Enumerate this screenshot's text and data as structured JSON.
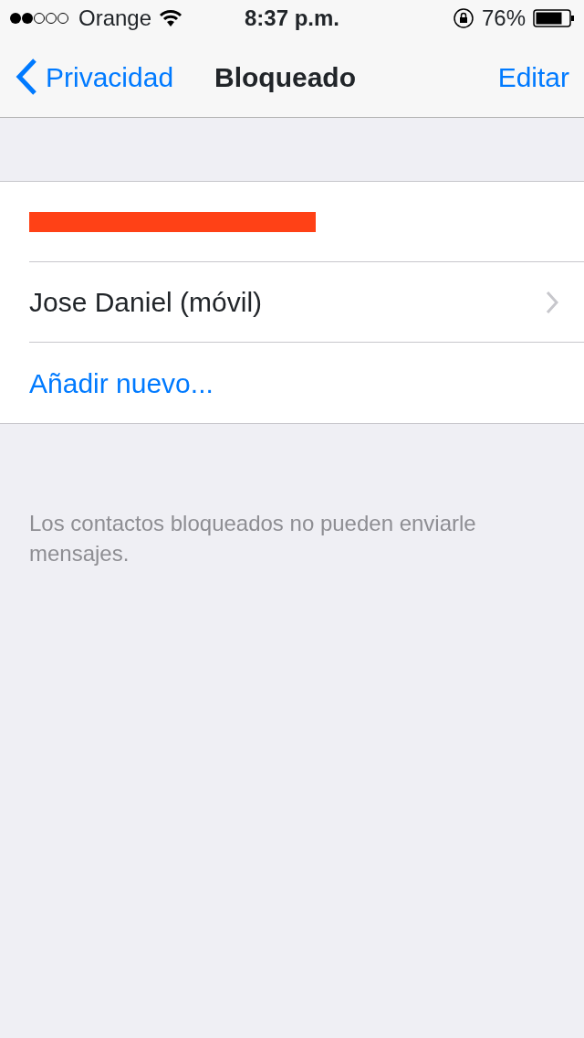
{
  "status_bar": {
    "carrier": "Orange",
    "time": "8:37 p.m.",
    "battery": "76%"
  },
  "nav_bar": {
    "back": "Privacidad",
    "title": "Bloqueado",
    "action": "Editar"
  },
  "rows": [
    {
      "kind": "redacted"
    },
    {
      "kind": "contact",
      "label": "Jose Daniel (móvil)"
    },
    {
      "kind": "add",
      "label": "Añadir nuevo..."
    }
  ],
  "footer": "Los contactos bloqueados no pueden enviarle mensajes."
}
